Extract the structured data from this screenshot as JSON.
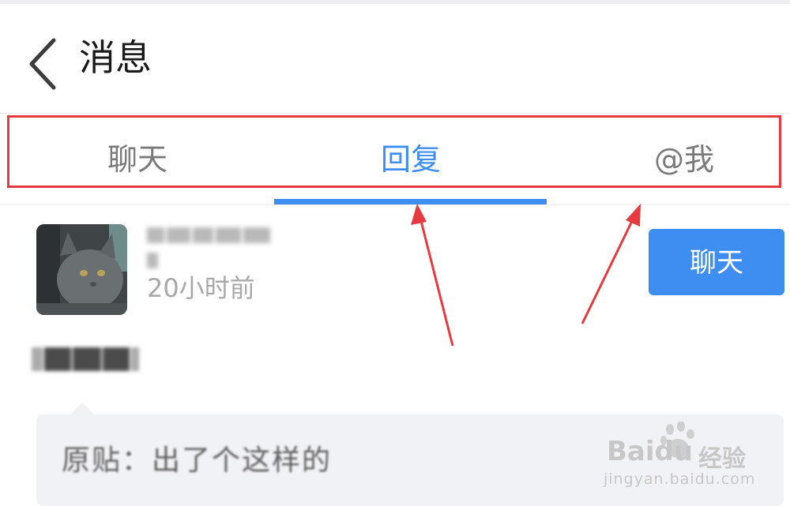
{
  "header": {
    "title": "消息"
  },
  "tabs": [
    {
      "label": "聊天",
      "active": false
    },
    {
      "label": "回复",
      "active": true
    },
    {
      "label": "@我",
      "active": false
    }
  ],
  "message": {
    "time": "20小时前",
    "chat_button": "聊天",
    "quote_text": "原贴：出了个这样的"
  },
  "watermark": {
    "brand": "Baidu",
    "cn": "经验",
    "url": "jingyan.baidu.com"
  },
  "colors": {
    "accent": "#3d8ef0",
    "annotation": "#e53a3f"
  }
}
